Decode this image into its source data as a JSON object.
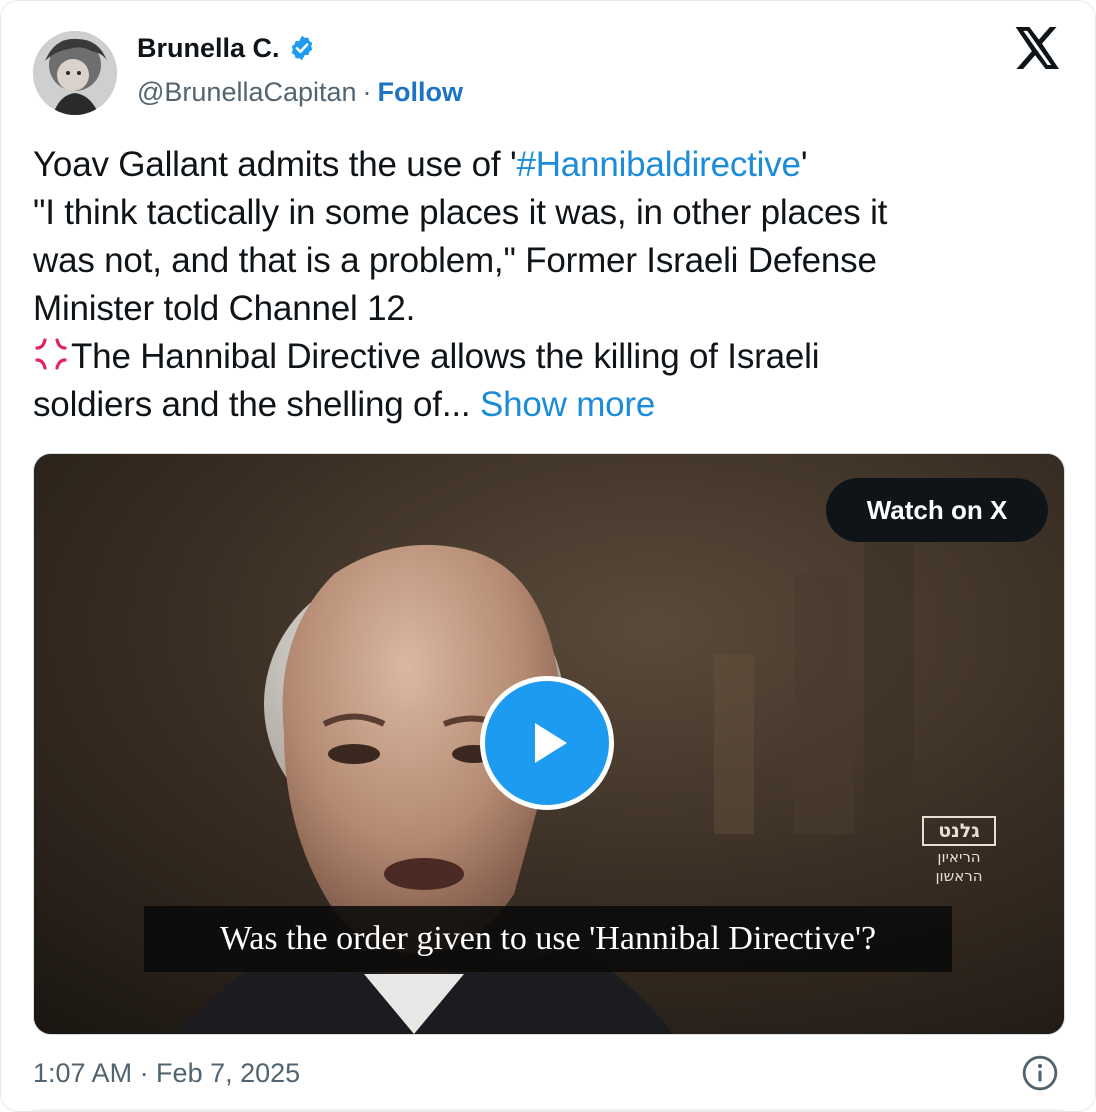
{
  "tweet": {
    "author": {
      "name": "Brunella C.",
      "handle": "@BrunellaCapitan",
      "separator": "·",
      "follow_label": "Follow",
      "verified": true,
      "verified_color": "#1d9bf0"
    },
    "text": {
      "line1_prefix": "Yoav Gallant admits the use of '",
      "hashtag": "#Hannibaldirective",
      "line1_suffix": "'",
      "line2": "\"I think tactically in some places it was, in other places it",
      "line3": "was not, and that is a problem,\" Former Israeli Defense",
      "line4": "Minister told Channel 12.",
      "line5": "The Hannibal Directive allows the killing of Israeli",
      "line6": "soldiers and the shelling of...",
      "show_more": "Show more",
      "emoji_icon": "anger-symbol-icon"
    },
    "media": {
      "type": "video",
      "watch_label": "Watch on X",
      "subtitle": "Was the order given to use 'Hannibal Directive'?",
      "channel_bug": {
        "title": "גלנט",
        "line1": "הריאיון",
        "line2": "הראשון"
      }
    },
    "timestamp": "1:07 AM · Feb 7, 2025",
    "platform_icon": "x-logo-icon",
    "info_icon": "info-icon",
    "colors": {
      "link": "#1d8cd8",
      "follow": "#1d74c4",
      "text": "#0f1419",
      "muted": "#536471",
      "play_button": "#1d9bf0"
    }
  }
}
